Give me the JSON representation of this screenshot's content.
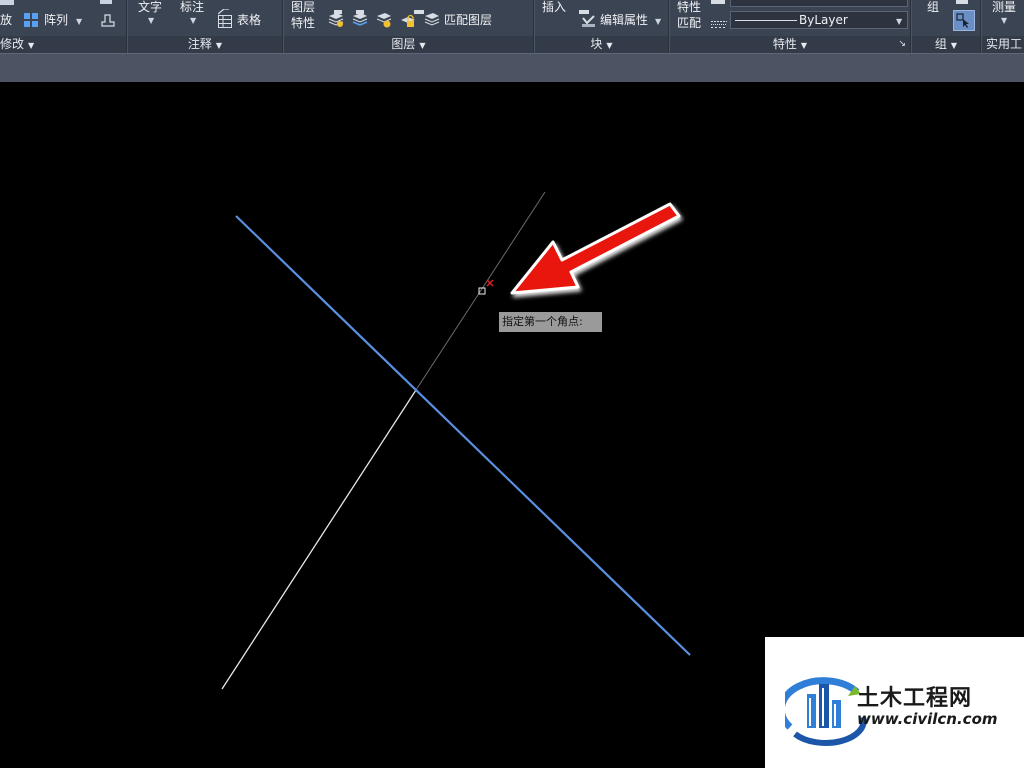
{
  "ribbon": {
    "modify": {
      "scale_label": "放",
      "array_label": "阵列",
      "title": "修改"
    },
    "annotation": {
      "text_label": "文字",
      "dimension_label": "标注",
      "table_label": "表格",
      "title": "注释"
    },
    "layers": {
      "layer_props_label": "图层\n特性",
      "layer_props_line1": "图层",
      "layer_props_line2": "特性",
      "match_layer_label": "匹配图层",
      "title": "图层"
    },
    "block": {
      "insert_label": "插入",
      "edit_attributes_label": "编辑属性",
      "title": "块"
    },
    "properties": {
      "match_line1": "特性",
      "match_line2": "匹配",
      "linetype_value": "ByLayer",
      "title": "特性"
    },
    "groups": {
      "group_label": "组",
      "title": "组"
    },
    "utilities": {
      "measure_label": "测量",
      "title": "实用工"
    }
  },
  "canvas": {
    "tooltip": "指定第一个角点:",
    "colors": {
      "blue_line": "#5b8fe0",
      "construction_line": "#e8e8e8",
      "arrow": "#e8140f",
      "cursor_x": "#e02020"
    }
  },
  "watermark": {
    "title": "土木工程网",
    "url": "www.civilcn.com"
  }
}
